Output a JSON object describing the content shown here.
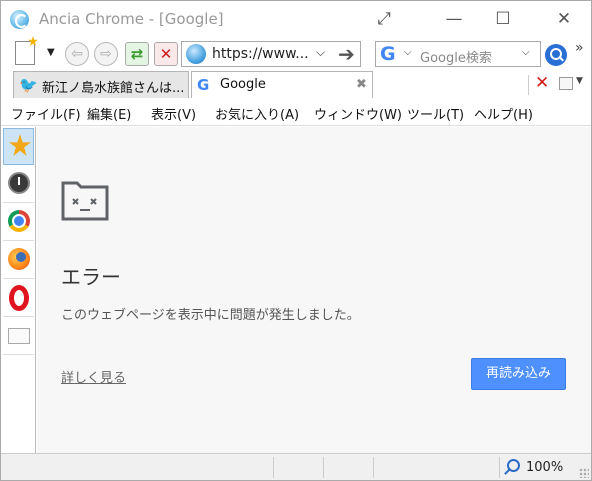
{
  "window": {
    "title": "Ancia Chrome - [Google]",
    "controls": {
      "restore": "⤢",
      "minimize": "—",
      "maximize": "☐",
      "close": "✕"
    }
  },
  "toolbar": {
    "url": "https://www...",
    "search_placeholder": "Google検索",
    "search_engine_glyph": "G",
    "more_glyph": "»"
  },
  "tabs": [
    {
      "label": "新江ノ島水族館さんは...",
      "icon": "twitter-bird-icon",
      "active": false
    },
    {
      "label": "Google",
      "icon": "google-g-icon",
      "active": true
    }
  ],
  "menubar": {
    "items": [
      "ファイル(F)",
      "編集(E)",
      "表示(V)",
      "お気に入り(A)",
      "ウィンドウ(W)",
      "ツール(T)",
      "ヘルプ(H)"
    ]
  },
  "sidebar": {
    "items": [
      "favorites-star-icon",
      "history-clock-icon",
      "chrome-icon",
      "firefox-icon",
      "opera-icon",
      "folder-icon"
    ]
  },
  "page": {
    "error_title": "エラー",
    "error_message": "このウェブページを表示中に問題が発生しました。",
    "learn_more": "詳しく見る",
    "reload_button": "再読み込み"
  },
  "status": {
    "zoom": "100%"
  },
  "colors": {
    "accent_blue": "#4d90fe",
    "stop_red": "#d01a1a",
    "reload_green": "#3b9b2f",
    "content_bg": "#f7f7f7"
  }
}
